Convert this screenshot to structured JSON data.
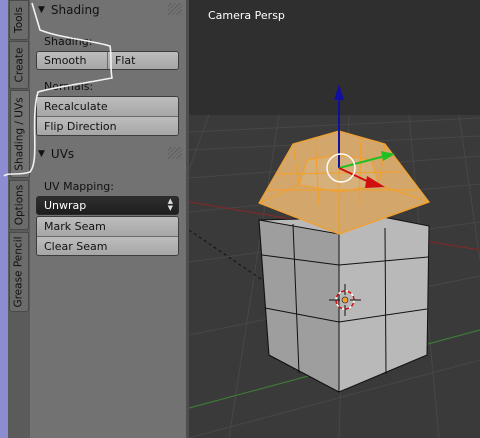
{
  "tabs": [
    {
      "label": "Tools"
    },
    {
      "label": "Create"
    },
    {
      "label": "Shading / UVs"
    },
    {
      "label": "Options"
    },
    {
      "label": "Grease Pencil"
    }
  ],
  "panel": {
    "shading_section": {
      "title": "Shading",
      "shading_label": "Shading:",
      "smooth": "Smooth",
      "flat": "Flat",
      "normals_label": "Normals:",
      "recalculate": "Recalculate",
      "flip_direction": "Flip Direction"
    },
    "uvs_section": {
      "title": "UVs",
      "uv_mapping_label": "UV Mapping:",
      "unwrap": "Unwrap",
      "mark_seam": "Mark Seam",
      "clear_seam": "Clear Seam"
    }
  },
  "viewport": {
    "title": "Camera Persp"
  },
  "colors": {
    "accent_strip": "#8c8cd0",
    "selection_orange": "#f0a030",
    "axis_z": "#1010a0",
    "axis_y": "#20c020",
    "axis_x": "#d01010"
  },
  "icons": [
    "panel-grip-icon",
    "triangle-down-icon",
    "dropdown-arrows-icon",
    "3d-cursor-icon",
    "manipulator-icon",
    "origin-dot-icon"
  ]
}
